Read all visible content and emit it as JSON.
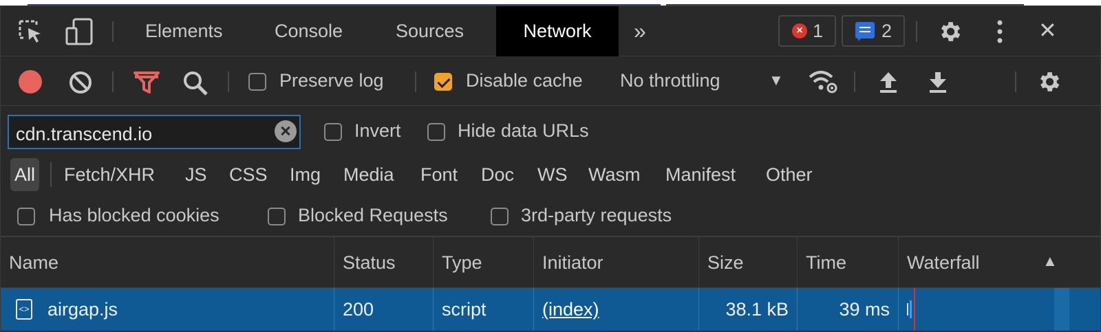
{
  "tabs": {
    "items": [
      {
        "label": "Elements"
      },
      {
        "label": "Console"
      },
      {
        "label": "Sources"
      },
      {
        "label": "Network"
      }
    ],
    "more": "»",
    "errors_count": "1",
    "messages_count": "2",
    "close": "✕"
  },
  "toolbar": {
    "preserve_log": "Preserve log",
    "preserve_log_checked": false,
    "disable_cache": "Disable cache",
    "disable_cache_checked": true,
    "throttling": "No throttling"
  },
  "filter": {
    "value": "cdn.transcend.io",
    "invert": "Invert",
    "hide_data_urls": "Hide data URLs",
    "types": [
      "All",
      "Fetch/XHR",
      "JS",
      "CSS",
      "Img",
      "Media",
      "Font",
      "Doc",
      "WS",
      "Wasm",
      "Manifest",
      "Other"
    ],
    "active_type": "All",
    "has_blocked_cookies": "Has blocked cookies",
    "blocked_requests": "Blocked Requests",
    "third_party": "3rd-party requests"
  },
  "table": {
    "columns": [
      "Name",
      "Status",
      "Type",
      "Initiator",
      "Size",
      "Time",
      "Waterfall"
    ],
    "sort_indicator": "▲",
    "rows": [
      {
        "name": "airgap.js",
        "status": "200",
        "type": "script",
        "initiator": "(index)",
        "size": "38.1 kB",
        "time": "39 ms"
      }
    ]
  },
  "colors": {
    "accent_blue": "#2d6fb0",
    "selected_row": "#0f5a94",
    "record_red": "#e8625e",
    "filter_red": "#e8625e",
    "checkbox_orange": "#f2a22a",
    "error_red": "#e0352b",
    "message_blue": "#2f6fe0"
  }
}
